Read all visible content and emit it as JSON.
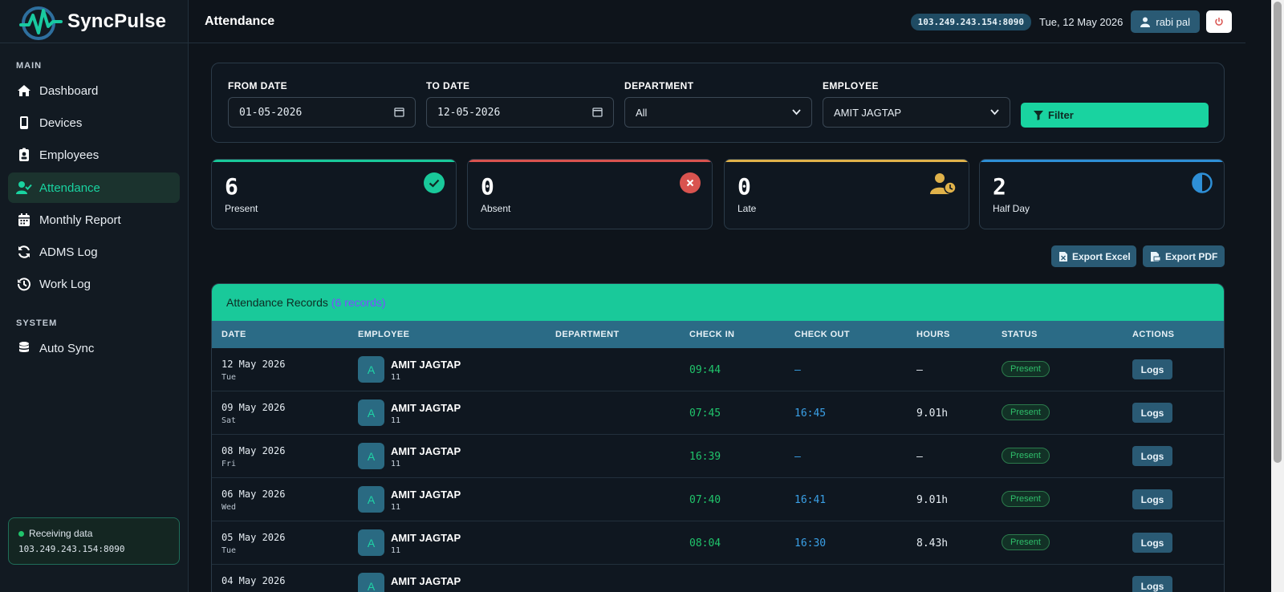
{
  "brand": {
    "name": "SyncPulse"
  },
  "sidebar": {
    "section_main": "MAIN",
    "section_system": "SYSTEM",
    "items": [
      {
        "label": "Dashboard",
        "icon": "home-icon"
      },
      {
        "label": "Devices",
        "icon": "mobile-icon"
      },
      {
        "label": "Employees",
        "icon": "id-badge-icon"
      },
      {
        "label": "Attendance",
        "icon": "user-check-icon",
        "active": true
      },
      {
        "label": "Monthly Report",
        "icon": "calendar-icon"
      },
      {
        "label": "ADMS Log",
        "icon": "refresh-icon"
      },
      {
        "label": "Work Log",
        "icon": "history-icon"
      }
    ],
    "system_items": [
      {
        "label": "Auto Sync",
        "icon": "database-icon"
      }
    ],
    "status": {
      "text": "Receiving data",
      "ip": "103.249.243.154:8090"
    }
  },
  "header": {
    "title": "Attendance",
    "ip": "103.249.243.154:8090",
    "date": "Tue, 12 May 2026",
    "user": "rabi pal"
  },
  "filters": {
    "from_label": "FROM DATE",
    "from_value": "01-05-2026",
    "to_label": "TO DATE",
    "to_value": "12-05-2026",
    "dept_label": "DEPARTMENT",
    "dept_value": "All",
    "emp_label": "EMPLOYEE",
    "emp_value": "AMIT JAGTAP",
    "button": "Filter"
  },
  "stats": [
    {
      "value": "6",
      "label": "Present",
      "color": "#19c99a"
    },
    {
      "value": "0",
      "label": "Absent",
      "color": "#d9534f"
    },
    {
      "value": "0",
      "label": "Late",
      "color": "#e0b24a"
    },
    {
      "value": "2",
      "label": "Half Day",
      "color": "#2e8fd6"
    }
  ],
  "export": {
    "excel": "Export Excel",
    "pdf": "Export PDF"
  },
  "records": {
    "title": "Attendance Records",
    "count": "(6 records)",
    "columns": [
      "DATE",
      "EMPLOYEE",
      "DEPARTMENT",
      "CHECK IN",
      "CHECK OUT",
      "HOURS",
      "STATUS",
      "ACTIONS"
    ],
    "rows": [
      {
        "date": "12 May 2026",
        "day": "Tue",
        "initial": "A",
        "name": "AMIT JAGTAP",
        "id": "11",
        "department": "",
        "check_in": "09:44",
        "check_out": "—",
        "hours": "—",
        "status": "Present",
        "action": "Logs"
      },
      {
        "date": "09 May 2026",
        "day": "Sat",
        "initial": "A",
        "name": "AMIT JAGTAP",
        "id": "11",
        "department": "",
        "check_in": "07:45",
        "check_out": "16:45",
        "hours": "9.01h",
        "status": "Present",
        "action": "Logs"
      },
      {
        "date": "08 May 2026",
        "day": "Fri",
        "initial": "A",
        "name": "AMIT JAGTAP",
        "id": "11",
        "department": "",
        "check_in": "16:39",
        "check_out": "—",
        "hours": "—",
        "status": "Present",
        "action": "Logs"
      },
      {
        "date": "06 May 2026",
        "day": "Wed",
        "initial": "A",
        "name": "AMIT JAGTAP",
        "id": "11",
        "department": "",
        "check_in": "07:40",
        "check_out": "16:41",
        "hours": "9.01h",
        "status": "Present",
        "action": "Logs"
      },
      {
        "date": "05 May 2026",
        "day": "Tue",
        "initial": "A",
        "name": "AMIT JAGTAP",
        "id": "11",
        "department": "",
        "check_in": "08:04",
        "check_out": "16:30",
        "hours": "8.43h",
        "status": "Present",
        "action": "Logs"
      },
      {
        "date": "04 May 2026",
        "day": "",
        "initial": "A",
        "name": "AMIT JAGTAP",
        "id": "",
        "department": "",
        "check_in": "",
        "check_out": "",
        "hours": "",
        "status": "",
        "action": "Logs"
      }
    ]
  }
}
